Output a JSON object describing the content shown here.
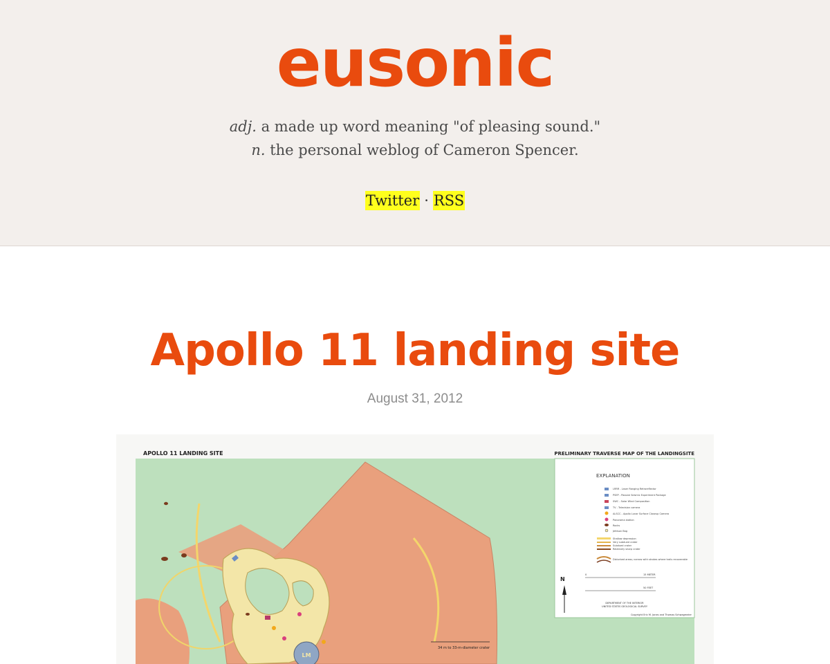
{
  "site": {
    "title": "eusonic",
    "tagline_line1_pos": "adj.",
    "tagline_line1_text": " a made up word meaning \"of pleasing sound.\"",
    "tagline_line2_pos": "n.",
    "tagline_line2_text": " the personal weblog of Cameron Spencer.",
    "links": [
      {
        "label": "Twitter"
      },
      {
        "label": "RSS"
      }
    ],
    "separator": "·"
  },
  "post": {
    "title": "Apollo 11 landing site",
    "date": "August 31, 2012"
  },
  "map": {
    "title_left": "APOLLO 11 LANDING SITE",
    "title_right": "PRELIMINARY TRAVERSE MAP OF THE LANDINGSITE",
    "explanation_heading": "EXPLANATION",
    "legend": [
      "LRRR - Laser Ranging Retroreflector",
      "PSEP - Passive Seismic Experiment Package",
      "SWC - Solar Wind Composition",
      "TV - Television camera",
      "ALSCC - Apollo Lunar Surface Closeup Camera",
      "Panorama station",
      "Rocks",
      "Jettison Bag",
      "Shallow depression",
      "Very subdued crater",
      "Subdued crater",
      "Relatively sharp crater",
      "Disturbed areas; narrow with strokes where trails recoverable"
    ],
    "scale_top_left": "0",
    "scale_top_right": "15 METER",
    "scale_bottom_right": "50 FEET",
    "north": "N",
    "dept": "DEPARTMENT OF THE INTERIOR",
    "survey": "UNITED STATES GEOLOGICAL SURVEY",
    "copyright": "Copyright Eric M. Jones and Thomas Schwagmeier",
    "crater_label": "34 m to 33-m-diameter crater",
    "lm_label": "LM",
    "colors": {
      "ground": "#bde0bd",
      "ejecta": "#e9a07d",
      "disturbed": "#f3e6a8",
      "trail": "#f4d66b",
      "rock": "#7a3b1e"
    }
  }
}
